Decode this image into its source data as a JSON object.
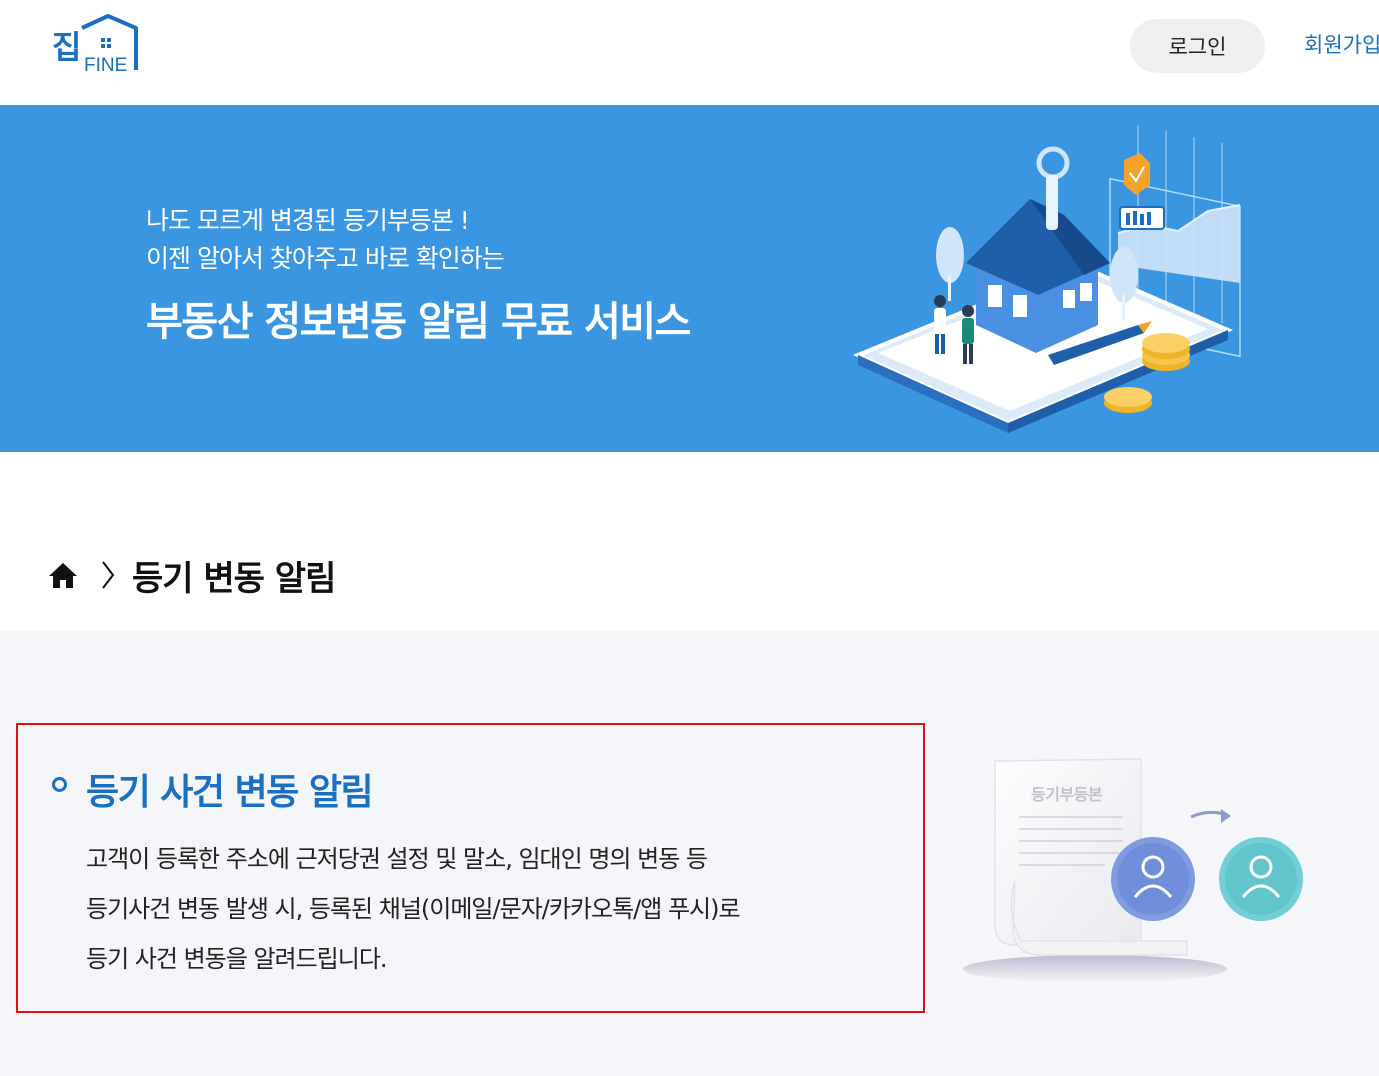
{
  "header": {
    "logo_text": "집 FINE",
    "login_label": "로그인",
    "join_label": "회원가입"
  },
  "hero": {
    "line1": "나도 모르게 변경된 등기부등본 !",
    "line2": "이젠 알아서 찾아주고 바로 확인하는",
    "title": "부동산 정보변동 알림 무료 서비스"
  },
  "breadcrumb": {
    "home_icon": "home-icon",
    "separator_icon": "chevron-right-icon",
    "current": "등기 변동 알림"
  },
  "section": {
    "title": "등기 사건 변동 알림",
    "lines": [
      "고객이 등록한 주소에 근저당권 설정 및 말소, 임대인 명의 변동 등",
      "등기사건 변동 발생 시, 등록된 채널(이메일/문자/카카오톡/앱 푸시)로",
      "등기 사건 변동을 알려드립니다."
    ],
    "document_label": "등기부등본",
    "highlight_color": "#e01010"
  },
  "colors": {
    "brand": "#1a6fc1",
    "hero_bg": "#3a96e0",
    "content_bg": "#f5f6f9"
  }
}
